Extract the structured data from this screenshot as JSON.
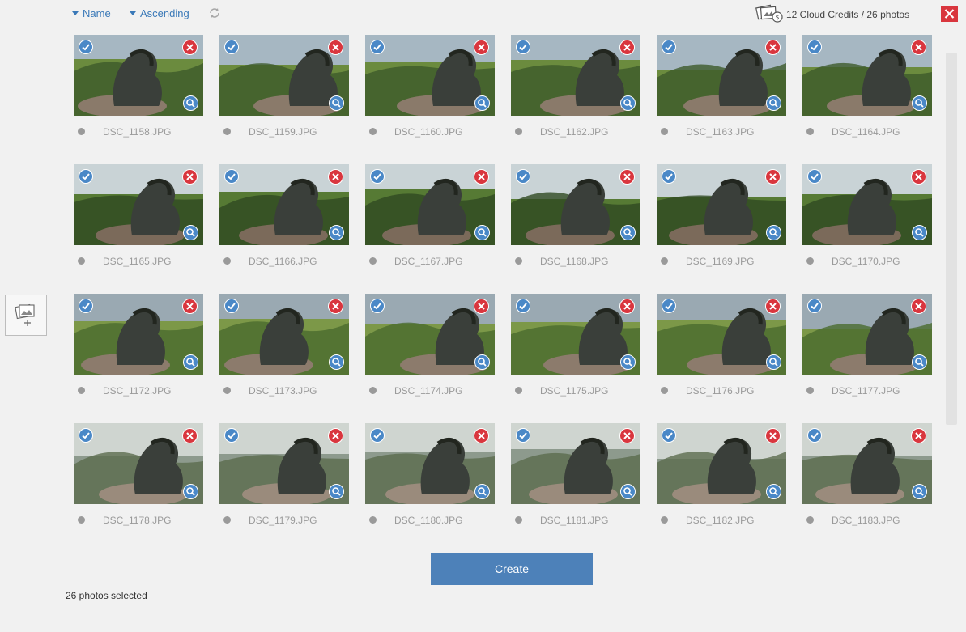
{
  "toolbar": {
    "sort_field": "Name",
    "sort_order": "Ascending",
    "credits_text": "12 Cloud Credits / 26 photos",
    "refresh_icon": "refresh-icon",
    "close_icon": "close-icon",
    "credits_icon": "cloud-credits-icon"
  },
  "photos": [
    {
      "name": "DSC_1158.JPG"
    },
    {
      "name": "DSC_1159.JPG"
    },
    {
      "name": "DSC_1160.JPG"
    },
    {
      "name": "DSC_1162.JPG"
    },
    {
      "name": "DSC_1163.JPG"
    },
    {
      "name": "DSC_1164.JPG"
    },
    {
      "name": "DSC_1165.JPG"
    },
    {
      "name": "DSC_1166.JPG"
    },
    {
      "name": "DSC_1167.JPG"
    },
    {
      "name": "DSC_1168.JPG"
    },
    {
      "name": "DSC_1169.JPG"
    },
    {
      "name": "DSC_1170.JPG"
    },
    {
      "name": "DSC_1172.JPG"
    },
    {
      "name": "DSC_1173.JPG"
    },
    {
      "name": "DSC_1174.JPG"
    },
    {
      "name": "DSC_1175.JPG"
    },
    {
      "name": "DSC_1176.JPG"
    },
    {
      "name": "DSC_1177.JPG"
    },
    {
      "name": "DSC_1178.JPG"
    },
    {
      "name": "DSC_1179.JPG"
    },
    {
      "name": "DSC_1180.JPG"
    },
    {
      "name": "DSC_1181.JPG"
    },
    {
      "name": "DSC_1182.JPG"
    },
    {
      "name": "DSC_1183.JPG"
    }
  ],
  "footer": {
    "create_label": "Create",
    "selected_text": "26 photos selected"
  },
  "colors": {
    "accent": "#4a88c7",
    "remove": "#d9363e",
    "button": "#4d81b9"
  }
}
